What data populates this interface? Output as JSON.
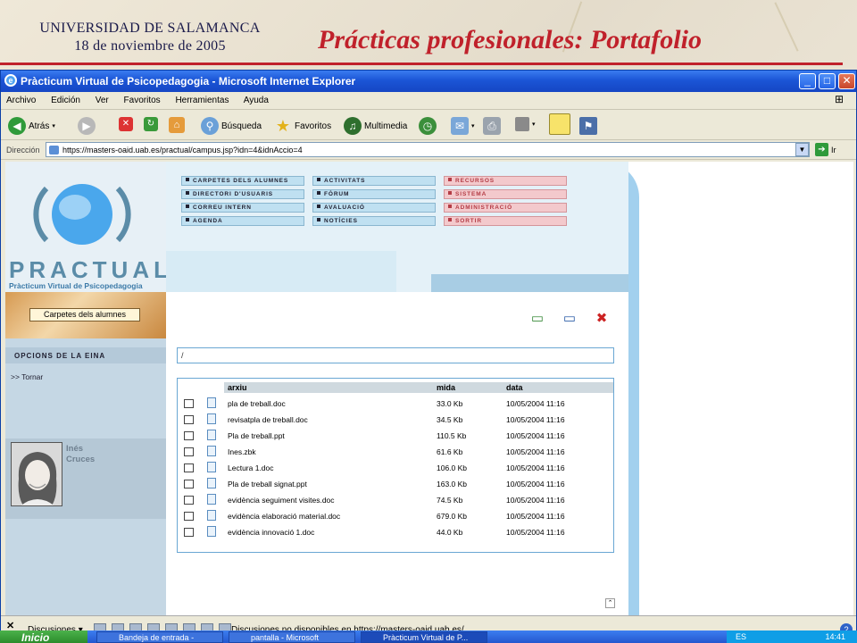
{
  "slide": {
    "university": "UNIVERSIDAD DE SALAMANCA",
    "date": "18 de noviembre de 2005",
    "title": "Prácticas profesionales: Portafolio"
  },
  "window": {
    "title": "Pràcticum Virtual de Psicopedagogia - Microsoft Internet Explorer",
    "minimize": "_",
    "maximize": "□",
    "close": "✕"
  },
  "menubar": [
    "Archivo",
    "Edición",
    "Ver",
    "Favoritos",
    "Herramientas",
    "Ayuda"
  ],
  "toolbar": {
    "back": "Atrás",
    "search": "Búsqueda",
    "favorites": "Favoritos",
    "multimedia": "Multimedia"
  },
  "address": {
    "label": "Dirección",
    "url": "https://masters-oaid.uab.es/practual/campus.jsp?idn=4&idnAccio=4",
    "go": "Ir"
  },
  "site": {
    "brand": "PRACTUAL",
    "brand_sub": "Pràcticum Virtual de Psicopedagogia",
    "menu_col1": [
      "CARPETES DELS ALUMNES",
      "DIRECTORI D'USUARIS",
      "CORREU INTERN",
      "AGENDA"
    ],
    "menu_col2": [
      "ACTIVITATS",
      "FÒRUM",
      "AVALUACIÓ",
      "NOTÍCIES"
    ],
    "menu_col3": [
      "RECURSOS",
      "SISTEMA",
      "ADMINISTRACIÓ",
      "SORTIR"
    ],
    "section_label": "Carpetes dels alumnes",
    "options_title": "OPCIONS DE LA EINA",
    "back_link": ">> Tornar",
    "user_first": "Inés",
    "user_last": "Cruces",
    "path": "/"
  },
  "files": {
    "headers": [
      "arxiu",
      "mida",
      "data"
    ],
    "rows": [
      [
        "pla de treball.doc",
        "33.0 Kb",
        "10/05/2004 11:16"
      ],
      [
        "revisatpla de treball.doc",
        "34.5 Kb",
        "10/05/2004 11:16"
      ],
      [
        "Pla de treball.ppt",
        "110.5 Kb",
        "10/05/2004 11:16"
      ],
      [
        "Ines.zbk",
        "61.6 Kb",
        "10/05/2004 11:16"
      ],
      [
        "Lectura 1.doc",
        "106.0 Kb",
        "10/05/2004 11:16"
      ],
      [
        "Pla de treball signat.ppt",
        "163.0 Kb",
        "10/05/2004 11:16"
      ],
      [
        "evidència seguiment visites.doc",
        "74.5 Kb",
        "10/05/2004 11:16"
      ],
      [
        "evidència elaboració material.doc",
        "679.0 Kb",
        "10/05/2004 11:16"
      ],
      [
        "evidència innovació 1.doc",
        "44.0 Kb",
        "10/05/2004 11:16"
      ]
    ]
  },
  "discussions": {
    "close": "✕",
    "label": "Discusiones ▾",
    "message": "Discusiones no disponibles en https://masters-oaid.uab.es/",
    "help": "?"
  },
  "taskbar": {
    "start": "Inicio",
    "tasks": [
      "Bandeja de entrada -",
      "pantalla - Microsoft",
      "Pràcticum Virtual de P..."
    ],
    "lang": "ES",
    "time": "14:41"
  },
  "colors": {
    "title_red": "#c0212b",
    "xp_blue": "#1b55d6",
    "practual_blue": "#a2d0ee",
    "menu_pink": "#f3c9cc"
  }
}
